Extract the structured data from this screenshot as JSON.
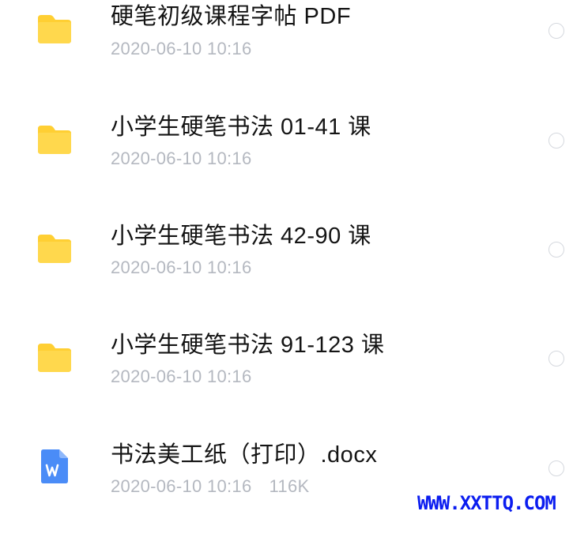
{
  "files": [
    {
      "name": "硬笔初级课程字帖  PDF",
      "date": "2020-06-10 10:16",
      "size": "",
      "icon": "folder-icon"
    },
    {
      "name": "小学生硬笔书法 01-41 课",
      "date": "2020-06-10 10:16",
      "size": "",
      "icon": "folder-icon"
    },
    {
      "name": "小学生硬笔书法 42-90 课",
      "date": "2020-06-10 10:16",
      "size": "",
      "icon": "folder-icon"
    },
    {
      "name": "小学生硬笔书法 91-123 课",
      "date": "2020-06-10 10:16",
      "size": "",
      "icon": "folder-icon"
    },
    {
      "name": "书法美工纸（打印）.docx",
      "date": "2020-06-10 10:16",
      "size": "116K",
      "icon": "word-document-icon"
    }
  ],
  "colors": {
    "folder": "#FFD84D",
    "folder_tab": "#FFCF33",
    "word_doc": "#4A8CF7",
    "name_text": "#141414",
    "meta_text": "#B4B8C0",
    "radio_border": "#D5D8DE",
    "watermark": "#0B1DF0"
  },
  "watermark": "WWW.XXTTQ.COM"
}
